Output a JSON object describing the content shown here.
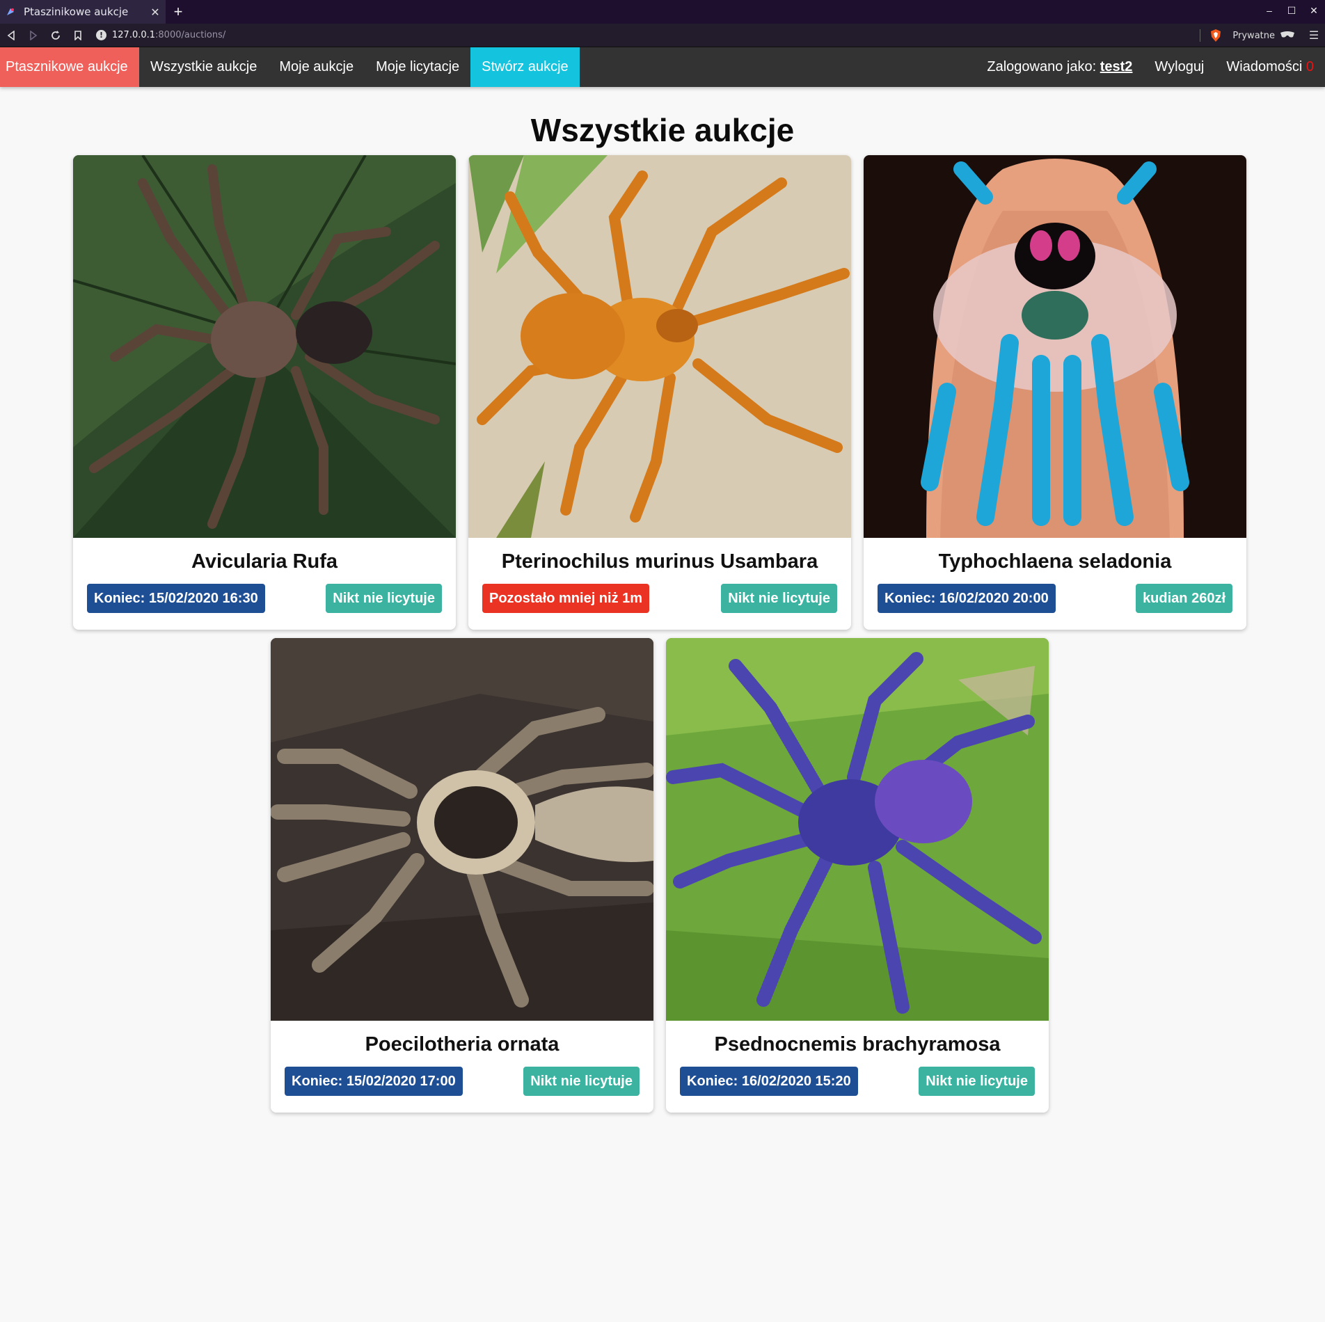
{
  "browser": {
    "tab_title": "Ptaszinikowe aukcje",
    "url_host": "127.0.0.1",
    "url_path": ":8000/auctions/",
    "private_label": "Prywatne"
  },
  "nav": {
    "brand": "Ptasznikowe aukcje",
    "all": "Wszystkie aukcje",
    "mine": "Moje aukcje",
    "bids": "Moje licytacje",
    "create": "Stwórz aukcje",
    "logged_prefix": "Zalogowano jako:",
    "username": "test2",
    "logout": "Wyloguj",
    "messages": "Wiadomości",
    "message_count": "0"
  },
  "page": {
    "title": "Wszystkie aukcje"
  },
  "auctions": [
    {
      "name": "Avicularia Rufa",
      "status": "Koniec: 15/02/2020 16:30",
      "bid": "Nikt nie licytuje",
      "image": "brown-tarantula-on-green-leaf"
    },
    {
      "name": "Pterinochilus murinus Usambara",
      "status": "Pozostało mniej niż 1m",
      "bid": "Nikt nie licytuje",
      "image": "orange-tarantula-on-sand"
    },
    {
      "name": "Typhochlaena seladonia",
      "status": "Koniec: 16/02/2020 20:00",
      "bid": "kudian 260zł",
      "image": "blue-pink-tarantula-on-finger"
    },
    {
      "name": "Poecilotheria ornata",
      "status": "Koniec: 15/02/2020 17:00",
      "bid": "Nikt nie licytuje",
      "image": "patterned-tarantula-on-bark"
    },
    {
      "name": "Psednocnemis brachyramosa",
      "status": "Koniec: 16/02/2020 15:20",
      "bid": "Nikt nie licytuje",
      "image": "blue-tarantula-on-moss"
    }
  ],
  "colors": {
    "brand_bg": "#f0605a",
    "create_bg": "#14c3dd",
    "badge_blue": "#1e4f95",
    "badge_red": "#eb3324",
    "badge_teal": "#3bb3a0"
  }
}
